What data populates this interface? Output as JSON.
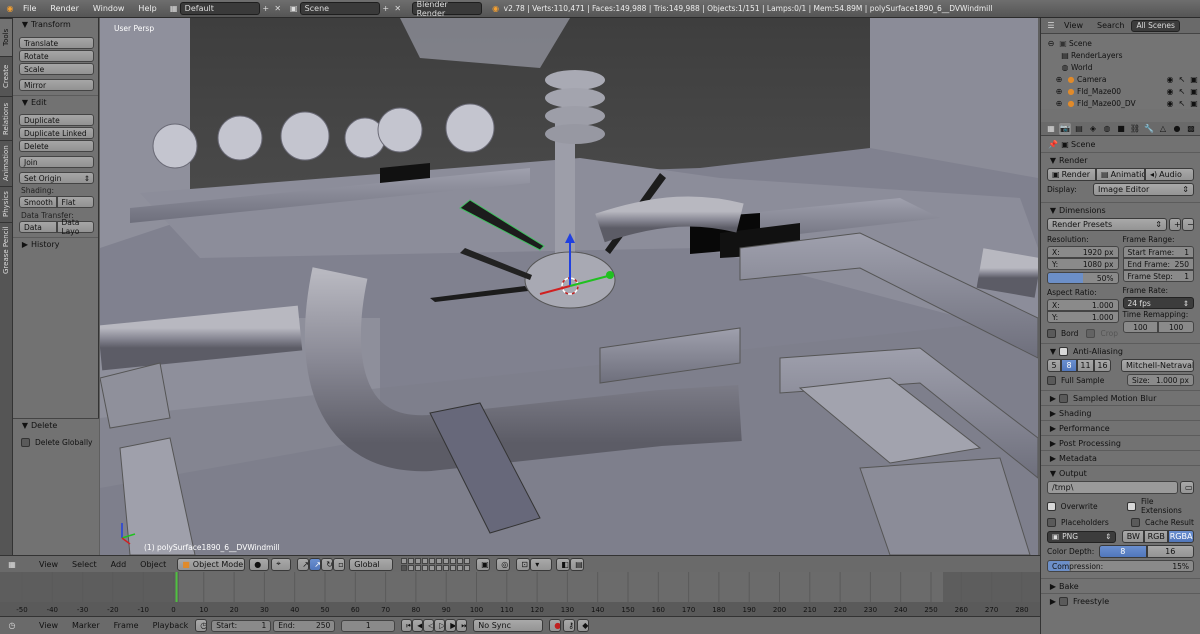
{
  "topbar": {
    "menus": [
      "File",
      "Render",
      "Window",
      "Help"
    ],
    "screen_layout": "Default",
    "scene": "Scene",
    "engine": "Blender Render",
    "stats": "v2.78 | Verts:110,471 | Faces:149,988 | Tris:149,988 | Objects:1/151 | Lamps:0/1 | Mem:54.89M | polySurface1890_6__DVWindmill"
  },
  "vtabs": [
    "Tools",
    "Create",
    "Relations",
    "Animation",
    "Physics",
    "Grease Pencil"
  ],
  "tools": {
    "transform_title": "Transform",
    "transform": [
      "Translate",
      "Rotate",
      "Scale"
    ],
    "mirror": "Mirror",
    "edit_title": "Edit",
    "edit": [
      "Duplicate",
      "Duplicate Linked",
      "Delete"
    ],
    "join": "Join",
    "set_origin": "Set Origin",
    "shading_label": "Shading:",
    "smooth": "Smooth",
    "flat": "Flat",
    "data_transfer_label": "Data Transfer:",
    "data": "Data",
    "data_layout": "Data Layo",
    "history": "History",
    "delete_title": "Delete",
    "delete_globally": "Delete Globally"
  },
  "viewport": {
    "view_label": "User Persp",
    "object_label": "(1) polySurface1890_6__DVWindmill"
  },
  "vp_header": {
    "menus": [
      "View",
      "Select",
      "Add",
      "Object"
    ],
    "mode": "Object Mode",
    "orientation": "Global"
  },
  "timeline": {
    "ticks": [
      "-50",
      "-40",
      "-30",
      "-20",
      "-10",
      "0",
      "10",
      "20",
      "30",
      "40",
      "50",
      "60",
      "70",
      "80",
      "90",
      "100",
      "110",
      "120",
      "130",
      "140",
      "150",
      "160",
      "170",
      "180",
      "190",
      "200",
      "210",
      "220",
      "230",
      "240",
      "250",
      "260",
      "270",
      "280"
    ],
    "current_frame_value": 1,
    "menus": [
      "View",
      "Marker",
      "Frame",
      "Playback"
    ],
    "start_label": "Start:",
    "start": "1",
    "end_label": "End:",
    "end": "250",
    "current": "1",
    "sync": "No Sync"
  },
  "outliner": {
    "tabs": [
      "View",
      "Search",
      "All Scenes"
    ],
    "items": [
      "Scene",
      "RenderLayers",
      "World",
      "Camera",
      "Fld_Maze00",
      "Fld_Maze00_DV"
    ]
  },
  "props": {
    "breadcrumb": "Scene",
    "render_title": "Render",
    "render_buttons": [
      "Render",
      "Animation",
      "Audio"
    ],
    "display_label": "Display:",
    "display_value": "Image Editor",
    "dimensions_title": "Dimensions",
    "render_presets": "Render Presets",
    "resolution_label": "Resolution:",
    "res_x_label": "X:",
    "res_x": "1920 px",
    "res_y_label": "Y:",
    "res_y": "1080 px",
    "res_pct": "50%",
    "frame_range_label": "Frame Range:",
    "start_frame_label": "Start Frame:",
    "start_frame": "1",
    "end_frame_label": "End Frame:",
    "end_frame": "250",
    "frame_step_label": "Frame Step:",
    "frame_step": "1",
    "aspect_label": "Aspect Ratio:",
    "asp_x_label": "X:",
    "asp_x": "1.000",
    "asp_y_label": "Y:",
    "asp_y": "1.000",
    "frame_rate_label": "Frame Rate:",
    "fps": "24 fps",
    "time_remap_label": "Time Remapping:",
    "remap_old": "100",
    "remap_new": "100",
    "bord": "Bord",
    "crop": "Crop",
    "aa_title": "Anti-Aliasing",
    "aa_samples": [
      "5",
      "8",
      "11",
      "16"
    ],
    "aa_filter": "Mitchell-Netravali",
    "full_sample": "Full Sample",
    "size_label": "Size:",
    "size": "1.000 px",
    "collapsed": [
      "Sampled Motion Blur",
      "Shading",
      "Performance",
      "Post Processing",
      "Metadata"
    ],
    "output_title": "Output",
    "output_path": "/tmp\\",
    "overwrite": "Overwrite",
    "file_extensions": "File Extensions",
    "placeholders": "Placeholders",
    "cache_result": "Cache Result",
    "format": "PNG",
    "color_modes": [
      "BW",
      "RGB",
      "RGBA"
    ],
    "color_depth_label": "Color Depth:",
    "depths": [
      "8",
      "16"
    ],
    "compression_label": "Compression:",
    "compression": "15%",
    "bake": "Bake",
    "freestyle": "Freestyle"
  }
}
